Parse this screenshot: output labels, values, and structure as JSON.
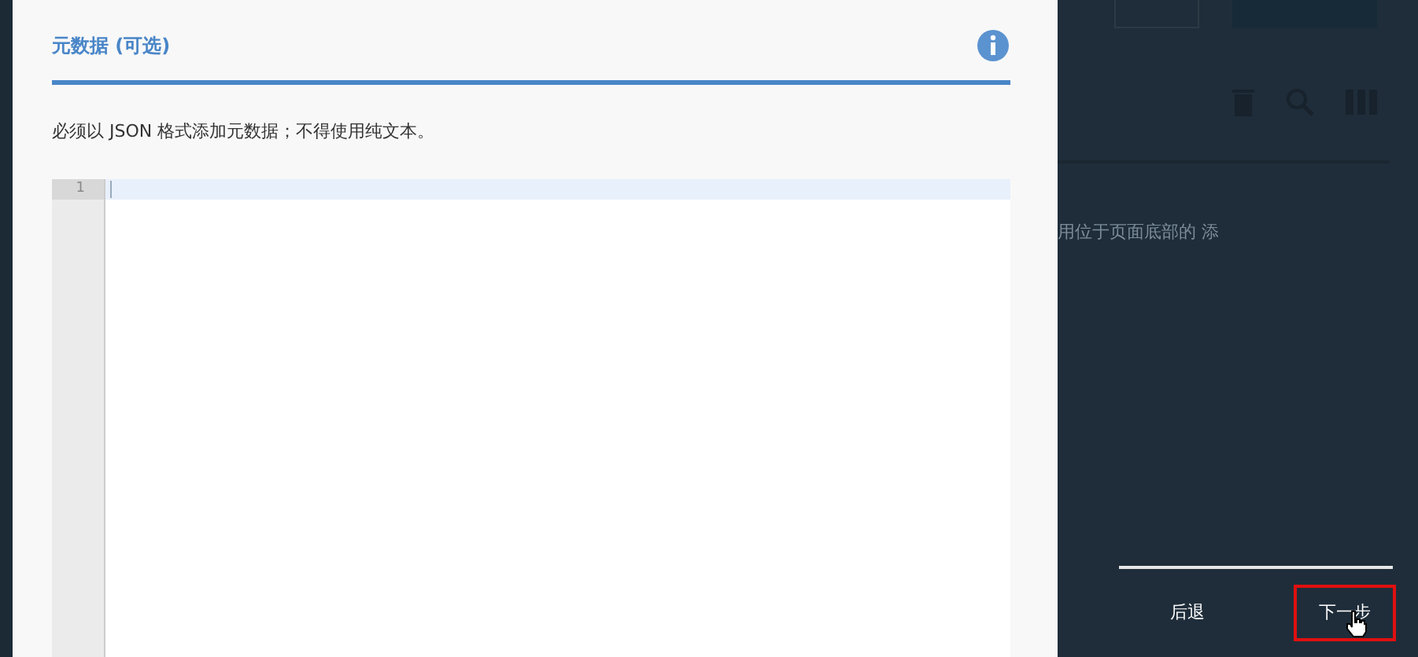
{
  "panel": {
    "title": "元数据 (可选)",
    "description": "必须以 JSON 格式添加元数据；不得使用纯文本。",
    "editor": {
      "line_numbers": [
        "1"
      ]
    }
  },
  "background": {
    "text": "用位于页面底部的 添"
  },
  "footer": {
    "buttons": [
      {
        "label": "后退",
        "highlighted": false
      },
      {
        "label": "下一步",
        "highlighted": true
      }
    ]
  }
}
